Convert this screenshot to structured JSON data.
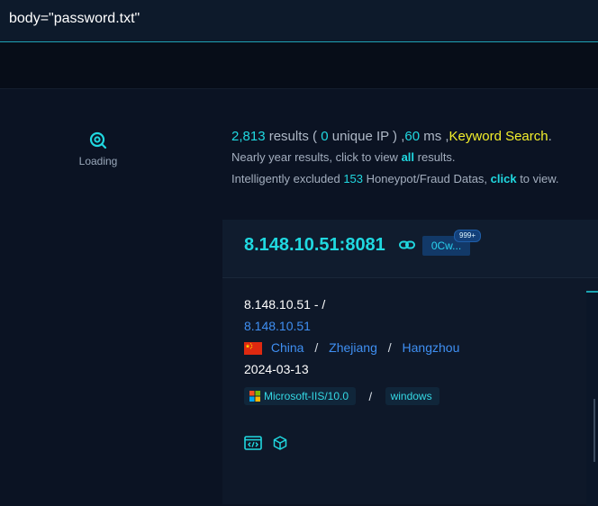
{
  "search": {
    "query": "body=\"password.txt\""
  },
  "loading": {
    "label": "Loading"
  },
  "summary": {
    "count": "2,813",
    "results_word": " results ( ",
    "unique_count": "0",
    "unique_word": " unique IP ) ,",
    "ms_value": "60",
    "ms_word": " ms ,",
    "mode": "Keyword Search",
    "period": ".",
    "line2_pre": "Nearly year results, click to view ",
    "line2_link": "all",
    "line2_post": " results.",
    "line3_pre": "Intelligently excluded ",
    "excluded_count": "153",
    "line3_mid": " Honeypot/Fraud Datas, ",
    "line3_link": "click",
    "line3_post": " to view."
  },
  "result": {
    "host": "8.148.10.51:8081",
    "tag_chip": "0Cw...",
    "tag_badge": "999+",
    "title": "8.148.10.51 - /",
    "ip": "8.148.10.51",
    "country": "China",
    "province": "Zhejiang",
    "city": "Hangzhou",
    "date": "2024-03-13",
    "sep": "/",
    "server": "Microsoft-IIS/10.0",
    "os": "windows"
  },
  "colors": {
    "accent": "#20d8e0",
    "keyword": "#f2ee2b",
    "link": "#3f8ff2",
    "background": "#0b1323"
  },
  "icons": [
    "search-loading-icon",
    "link-icon",
    "flag-china-icon",
    "microsoft-logo-icon",
    "code-icon",
    "cube-icon"
  ]
}
